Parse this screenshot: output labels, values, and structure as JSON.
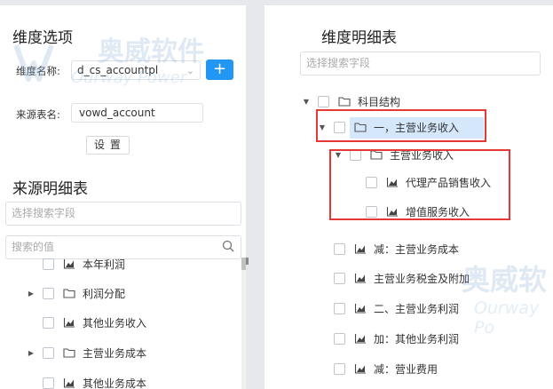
{
  "left": {
    "dimension_title": "维度选项",
    "dim_name_label": "维度名称:",
    "dim_name_value": "d_cs_accountpl",
    "add_button": "+",
    "source_table_label": "来源表名:",
    "source_table_value": "vowd_account",
    "setup_button": "设 置",
    "source_detail_title": "来源明细表",
    "search_field_placeholder": "选择搜索字段",
    "search_value_placeholder": "搜索的值",
    "tree": [
      {
        "label": "本年利润",
        "type": "chart",
        "arrow": false
      },
      {
        "label": "利润分配",
        "type": "folder",
        "arrow": true
      },
      {
        "label": "其他业务收入",
        "type": "chart",
        "arrow": false
      },
      {
        "label": "主营业务成本",
        "type": "folder",
        "arrow": true
      },
      {
        "label": "其他业务成本",
        "type": "chart",
        "arrow": false
      }
    ]
  },
  "right": {
    "detail_title": "维度明细表",
    "search_field_placeholder": "选择搜索字段",
    "tree": [
      {
        "label": "科目结构",
        "type": "folder",
        "arrow": true
      },
      {
        "label": "一，主营业务收入",
        "type": "folder",
        "arrow": true
      },
      {
        "label": "主营业务收入",
        "type": "folder",
        "arrow": true
      },
      {
        "label": "代理产品销售收入",
        "type": "chart",
        "arrow": false
      },
      {
        "label": "增值服务收入",
        "type": "chart",
        "arrow": false
      },
      {
        "label": "减：主营业务成本",
        "type": "chart",
        "arrow": false
      },
      {
        "label": "主营业务税金及附加",
        "type": "chart",
        "arrow": false
      },
      {
        "label": "二、主营业务利润",
        "type": "chart",
        "arrow": false
      },
      {
        "label": "加：其他业务利润",
        "type": "chart",
        "arrow": false
      },
      {
        "label": "减：营业费用",
        "type": "chart",
        "arrow": false
      }
    ]
  },
  "watermark": {
    "brand": "奥威软件",
    "brand_short": "奥威软",
    "sub": "Ourway Power",
    "sub_short": "Ourway Po",
    "logo": "w"
  },
  "colors": {
    "accent": "#2196f3",
    "highlight": "#e53935",
    "selected": "#d5e8fb"
  }
}
